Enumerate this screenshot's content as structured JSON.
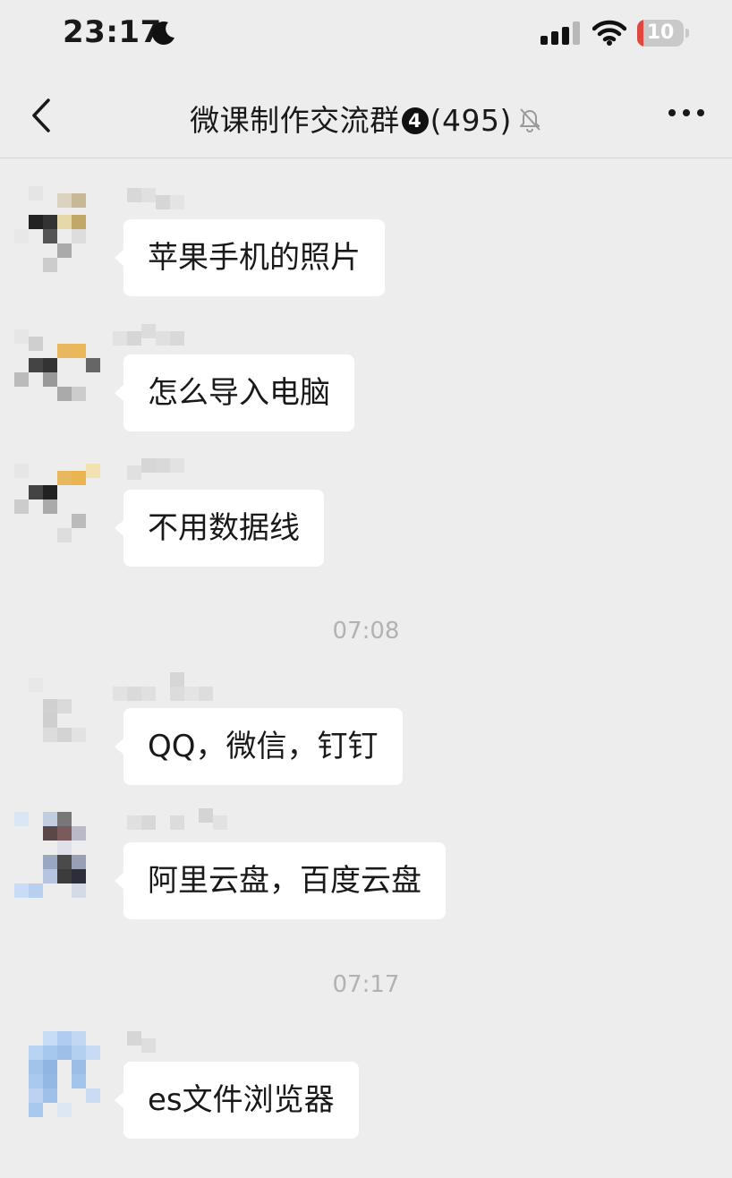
{
  "status_bar": {
    "time": "23:17",
    "battery": "10"
  },
  "header": {
    "title": "微课制作交流群",
    "badge": "4",
    "member_count": "(495)"
  },
  "messages": [
    {
      "text": "苹果手机的照片"
    },
    {
      "text": "怎么导入电脑"
    },
    {
      "text": "不用数据线"
    },
    {
      "timestamp": "07:08"
    },
    {
      "text": "QQ，微信，钉钉"
    },
    {
      "text": "阿里云盘，百度云盘"
    },
    {
      "timestamp": "07:17"
    },
    {
      "text": "es文件浏览器"
    }
  ],
  "colors": {
    "background": "#ededed",
    "bubble": "#ffffff",
    "timestamp": "#b2b2b2",
    "battery_low": "#e0463c"
  }
}
